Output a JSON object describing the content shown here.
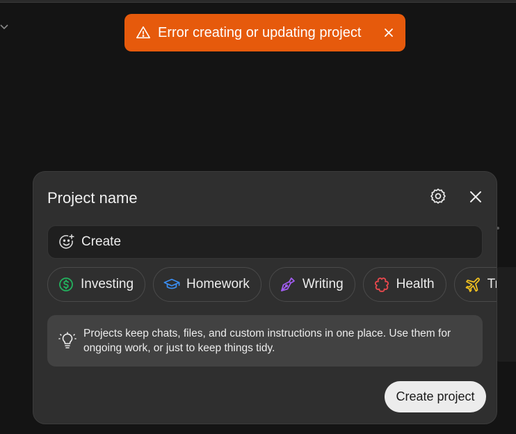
{
  "toast": {
    "icon": "warning-icon",
    "message": "Error creating or updating project",
    "close_icon": "close-icon",
    "color": "#e65a0c"
  },
  "dialog": {
    "title": "Project name",
    "settings_icon": "gear-icon",
    "close_icon": "close-icon",
    "name_input": {
      "placeholder": "Create",
      "value": "",
      "icon": "emoji-add-icon"
    },
    "categories": [
      {
        "label": "Investing",
        "icon": "dollar-icon",
        "color": "#22b35e"
      },
      {
        "label": "Homework",
        "icon": "graduation-cap-icon",
        "color": "#3b8ff5"
      },
      {
        "label": "Writing",
        "icon": "pen-icon",
        "color": "#a05cf0"
      },
      {
        "label": "Health",
        "icon": "health-icon",
        "color": "#e5484d"
      },
      {
        "label": "Travel",
        "icon": "plane-icon",
        "color": "#f0c020"
      }
    ],
    "info": {
      "icon": "lightbulb-icon",
      "text": "Projects keep chats, files, and custom instructions in one place. Use them for ongoing work, or just to keep things tidy."
    },
    "create_label": "Create project"
  }
}
